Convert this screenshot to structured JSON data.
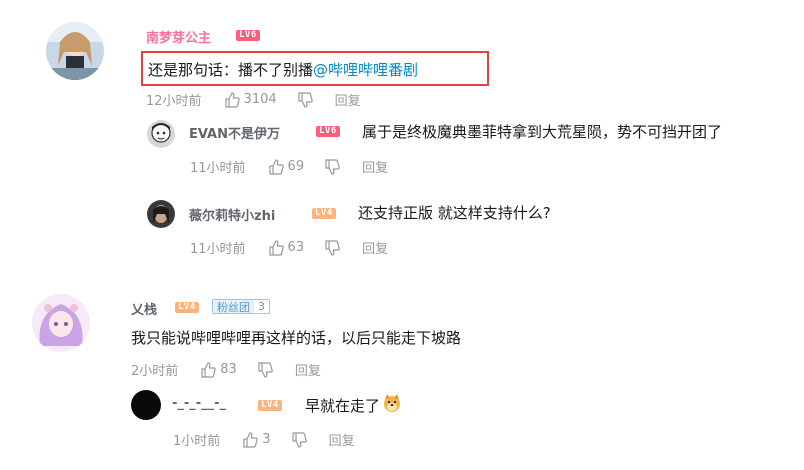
{
  "comments": [
    {
      "user": "南梦芽公主",
      "level": "LV6",
      "text_prefix": "还是那句话：播不了别播",
      "mention": "@哔哩哔哩番剧",
      "time": "12小时前",
      "likes": "3104",
      "reply_label": "回复",
      "replies": [
        {
          "user": "EVAN不是伊万",
          "level": "LV6",
          "text": "属于是终极魔典墨菲特拿到大荒星陨，势不可挡开团了",
          "time": "11小时前",
          "likes": "69",
          "reply_label": "回复"
        },
        {
          "user": "薇尔莉特小zhi",
          "level": "LV4",
          "text": "还支持正版 就这样支持什么?",
          "time": "11小时前",
          "likes": "63",
          "reply_label": "回复"
        }
      ]
    },
    {
      "user": "乂栈",
      "level": "LV4",
      "medal_label": "粉丝团",
      "medal_level": "3",
      "text": "我只能说哔哩哔哩再这样的话，以后只能走下坡路",
      "time": "2小时前",
      "likes": "83",
      "reply_label": "回复",
      "replies": [
        {
          "user": "-_-_-__-_",
          "level": "LV4",
          "text": "早就在走了",
          "emoji": "doge-emoji",
          "time": "1小时前",
          "likes": "3",
          "reply_label": "回复"
        }
      ]
    }
  ],
  "colors": {
    "username_vip": "#fb7299",
    "username": "#61666d",
    "mention": "#008ac5",
    "meta": "#9499a0",
    "highlight_border": "#e64340"
  }
}
